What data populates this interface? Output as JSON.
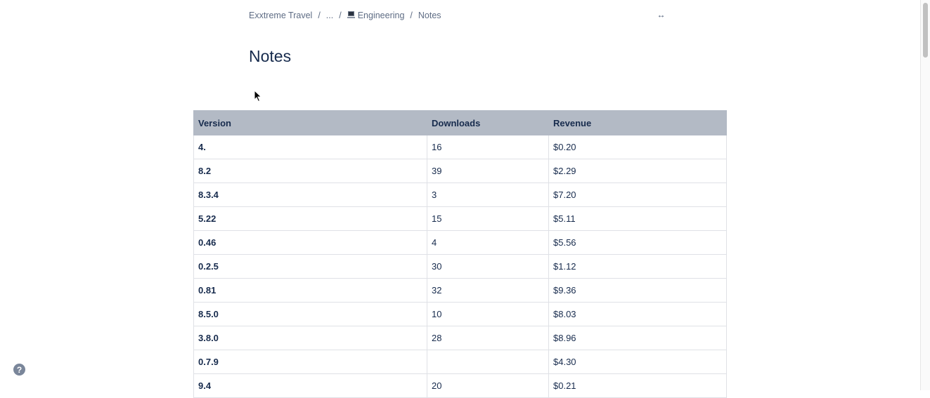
{
  "breadcrumb": {
    "space": "Exxtreme Travel",
    "ellipsis": "...",
    "parent": "Engineering",
    "current": "Notes",
    "separator": "/"
  },
  "page": {
    "title": "Notes"
  },
  "table": {
    "headers": [
      "Version",
      "Downloads",
      "Revenue"
    ],
    "rows": [
      [
        "4.",
        "16",
        "$0.20"
      ],
      [
        "8.2",
        "39",
        "$2.29"
      ],
      [
        "8.3.4",
        "3",
        "$7.20"
      ],
      [
        "5.22",
        "15",
        "$5.11"
      ],
      [
        "0.46",
        "4",
        "$5.56"
      ],
      [
        "0.2.5",
        "30",
        "$1.12"
      ],
      [
        "0.81",
        "32",
        "$9.36"
      ],
      [
        "8.5.0",
        "10",
        "$8.03"
      ],
      [
        "3.8.0",
        "28",
        "$8.96"
      ],
      [
        "0.7.9",
        "",
        "$4.30"
      ],
      [
        "9.4",
        "20",
        "$0.21"
      ]
    ]
  },
  "icons": {
    "width_toggle": "expand-width-icon",
    "help": "help-icon",
    "parent_emoji": "computer-icon"
  },
  "help": {
    "label": "?"
  },
  "colors": {
    "header_bg": "#b3bac5",
    "text": "#172b4d",
    "muted": "#5e6c84"
  }
}
